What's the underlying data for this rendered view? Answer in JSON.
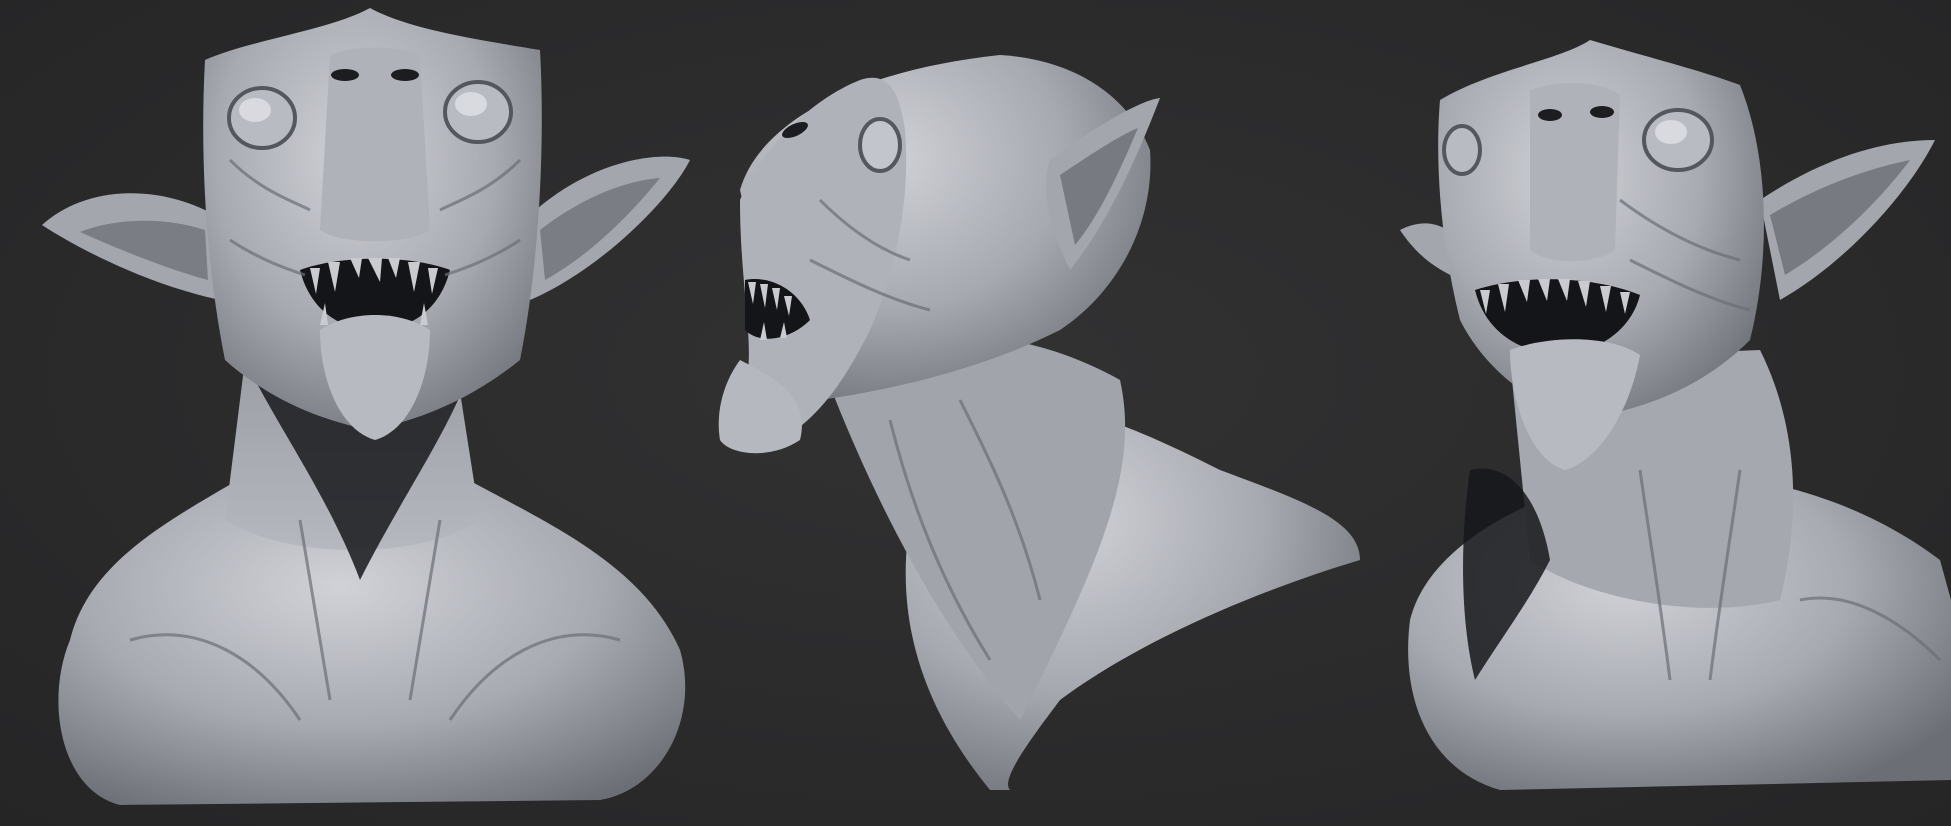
{
  "scene": {
    "background_color": "#2c2c2d",
    "clay_color": "#a7a9b0",
    "clay_highlight": "#d4d6dc",
    "clay_shadow": "#5e6068",
    "cavity_color": "#141518"
  },
  "views": [
    {
      "label": "",
      "angle": "front"
    },
    {
      "label": "",
      "angle": "left-profile-three-quarter"
    },
    {
      "label": "",
      "angle": "right-three-quarter"
    }
  ]
}
